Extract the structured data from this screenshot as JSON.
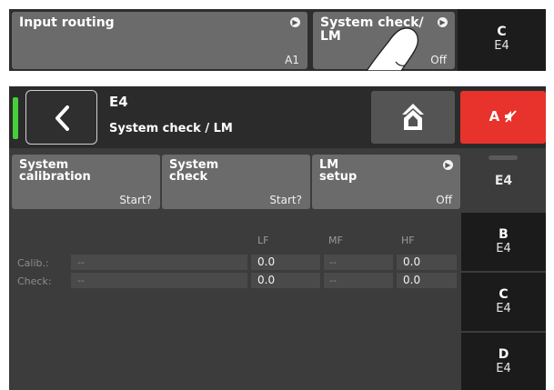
{
  "top_strip": {
    "input_routing": {
      "title": "Input routing",
      "value": "A1"
    },
    "system_check": {
      "title": "System check/\nLM",
      "value": "Off"
    },
    "channel_c": {
      "letter": "C",
      "sub": "E4"
    }
  },
  "header": {
    "title": "E4",
    "subtitle": "System check / LM",
    "mute_label": "A",
    "status_color": "#46cf3a",
    "mute_color": "#e8322c"
  },
  "params": [
    {
      "title": "System\ncalibration",
      "value": "Start?"
    },
    {
      "title": "System\ncheck",
      "value": "Start?"
    },
    {
      "title": "LM\nsetup",
      "value": "Off"
    }
  ],
  "grid": {
    "columns": [
      "LF",
      "MF",
      "HF"
    ],
    "rows": [
      {
        "label": "Calib.:",
        "status": "--",
        "lf": "0.0",
        "mf": "--",
        "hf": "0.0"
      },
      {
        "label": "Check:",
        "status": "--",
        "lf": "0.0",
        "mf": "--",
        "hf": "0.0"
      }
    ]
  },
  "channels": [
    {
      "letter": "",
      "sub": "E4",
      "active": true
    },
    {
      "letter": "B",
      "sub": "E4"
    },
    {
      "letter": "C",
      "sub": "E4"
    },
    {
      "letter": "D",
      "sub": "E4"
    }
  ],
  "icons": {
    "back": "chevron-left-icon",
    "home": "home-icon",
    "mute": "speaker-muted-icon",
    "tile_arrow": "chevron-right-circle-icon",
    "touch": "finger-touch-icon"
  }
}
